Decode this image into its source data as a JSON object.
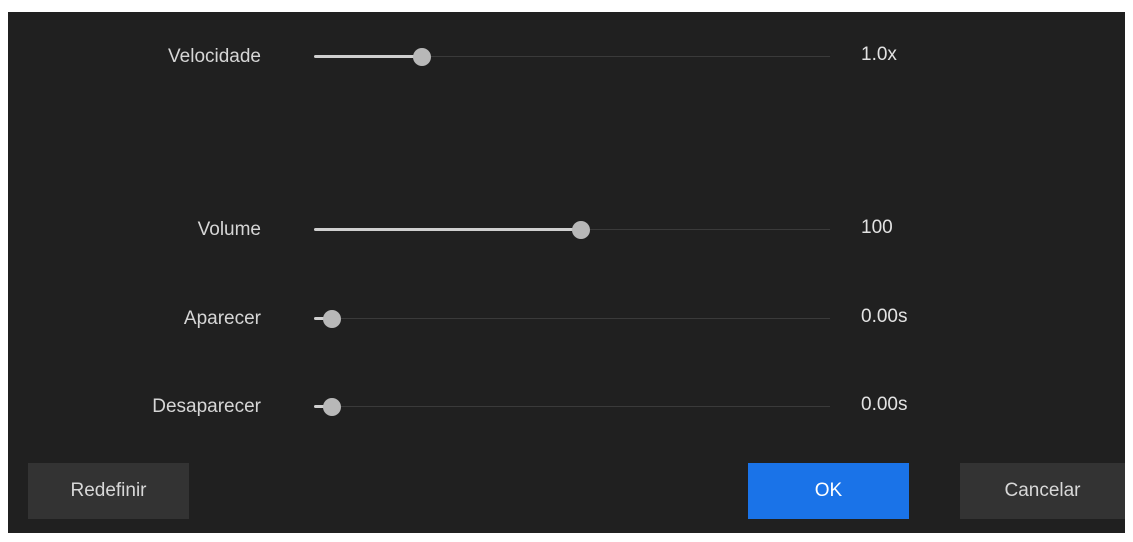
{
  "sliders": {
    "speed": {
      "label": "Velocidade",
      "value_text": "1.0x",
      "fraction": 0.18
    },
    "volume": {
      "label": "Volume",
      "value_text": "100",
      "fraction": 0.5
    },
    "fade_in": {
      "label": "Aparecer",
      "value_text": "0.00s",
      "fraction": 0.0
    },
    "fade_out": {
      "label": "Desaparecer",
      "value_text": "0.00s",
      "fraction": 0.0
    }
  },
  "buttons": {
    "reset_label": "Redefinir",
    "ok_label": "OK",
    "cancel_label": "Cancelar"
  },
  "colors": {
    "background": "#202020",
    "accent": "#1a73e8",
    "thumb": "#b8b8b8",
    "fill": "#cfcfcf"
  }
}
